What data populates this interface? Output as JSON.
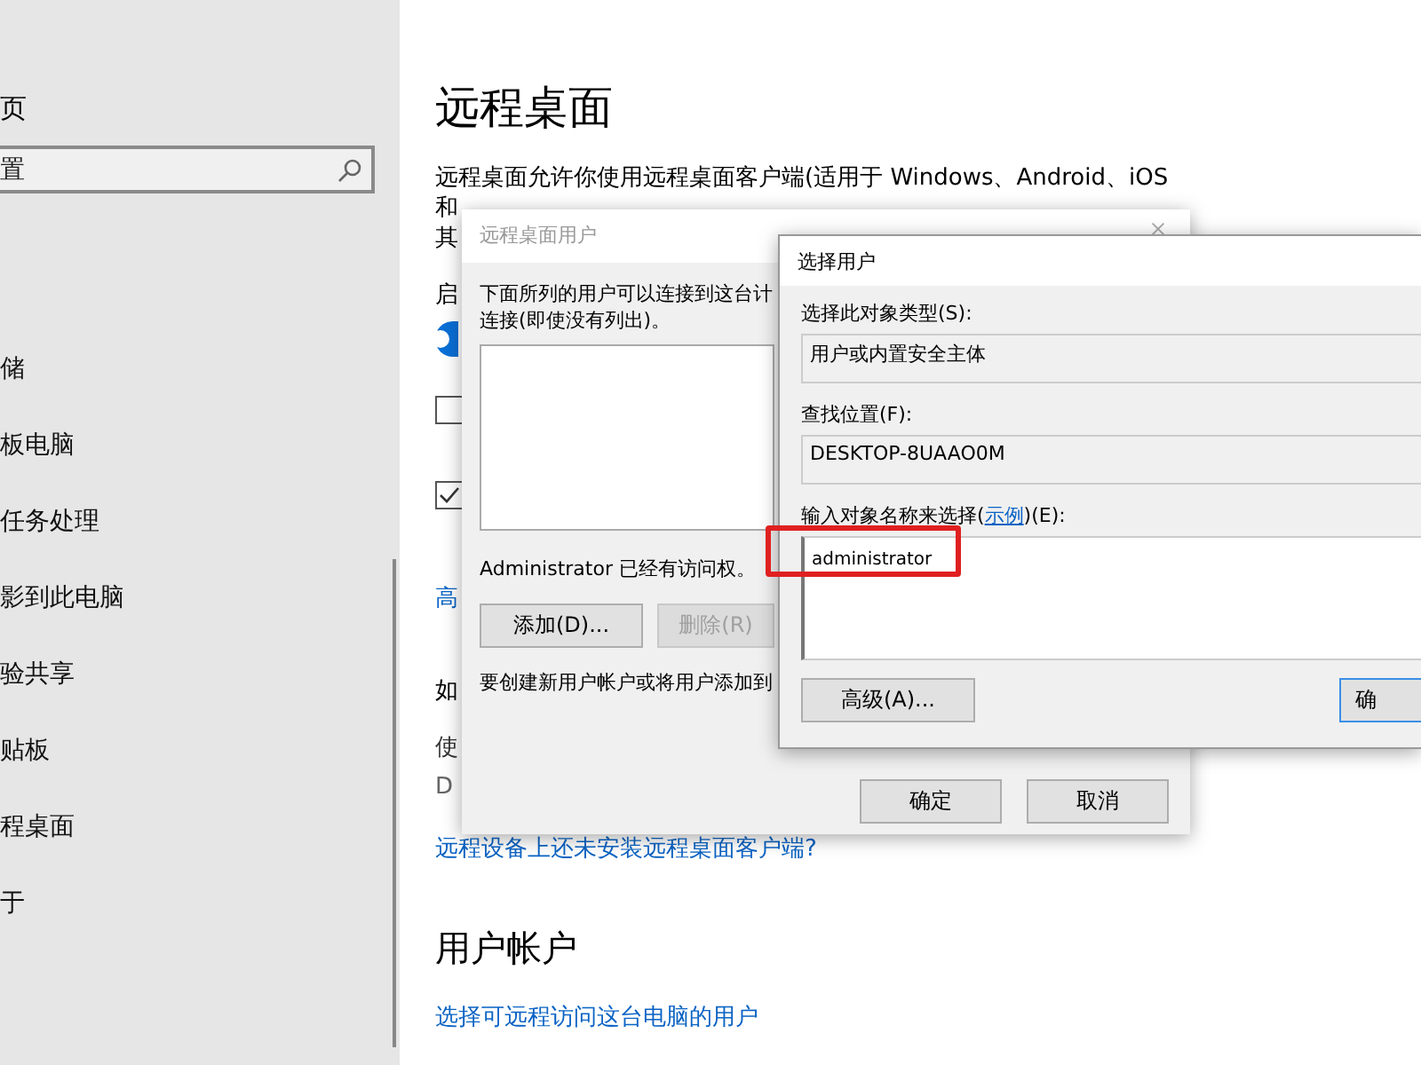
{
  "sidebar": {
    "home_label": "页",
    "search": {
      "placeholder": "置"
    },
    "items": [
      {
        "label": "储"
      },
      {
        "label": "板电脑"
      },
      {
        "label": "任务处理"
      },
      {
        "label": "影到此电脑"
      },
      {
        "label": "验共享"
      },
      {
        "label": "贴板"
      },
      {
        "label": "程桌面"
      },
      {
        "label": "于"
      }
    ]
  },
  "page": {
    "title": "远程桌面",
    "description_lines": [
      "远程桌面允许你使用远程桌面客户端(适用于 Windows、Android、iOS",
      "和",
      "其"
    ],
    "enable_label": "启",
    "toggle": {
      "on": true
    },
    "checkboxes": [
      {
        "checked": false
      },
      {
        "checked": true
      }
    ],
    "advanced_link": "高",
    "section_heading": "如",
    "info_label": "使",
    "info_value": "D",
    "client_link": "远程设备上还未安装远程桌面客户端?",
    "accounts_heading": "用户帐户",
    "users_link": "选择可远程访问这台电脑的用户"
  },
  "users_dialog": {
    "title": "远程桌面用户",
    "intro_lines": [
      "下面所列的用户可以连接到这台计",
      "连接(即使没有列出)。"
    ],
    "access_note": "Administrator 已经有访问权。",
    "buttons": [
      {
        "label": "添加(D)...",
        "disabled": false
      },
      {
        "label": "删除(R)",
        "disabled": true
      }
    ],
    "create_note": "要创建新用户帐户或将用户添加到",
    "footer_buttons": [
      "确定",
      "取消"
    ]
  },
  "select_dialog": {
    "title": "选择用户",
    "object_type_label": "选择此对象类型(S):",
    "object_type_value": "用户或内置安全主体",
    "location_label": "查找位置(F):",
    "location_value": "DESKTOP-8UAAO0M",
    "names_label_parts": {
      "before": "输入对象名称来选择(",
      "link": "示例",
      "after": ")(E):"
    },
    "names_value": "administrator",
    "name_highlight": true,
    "advanced_button": "高级(A)...",
    "ok_button": "确"
  }
}
